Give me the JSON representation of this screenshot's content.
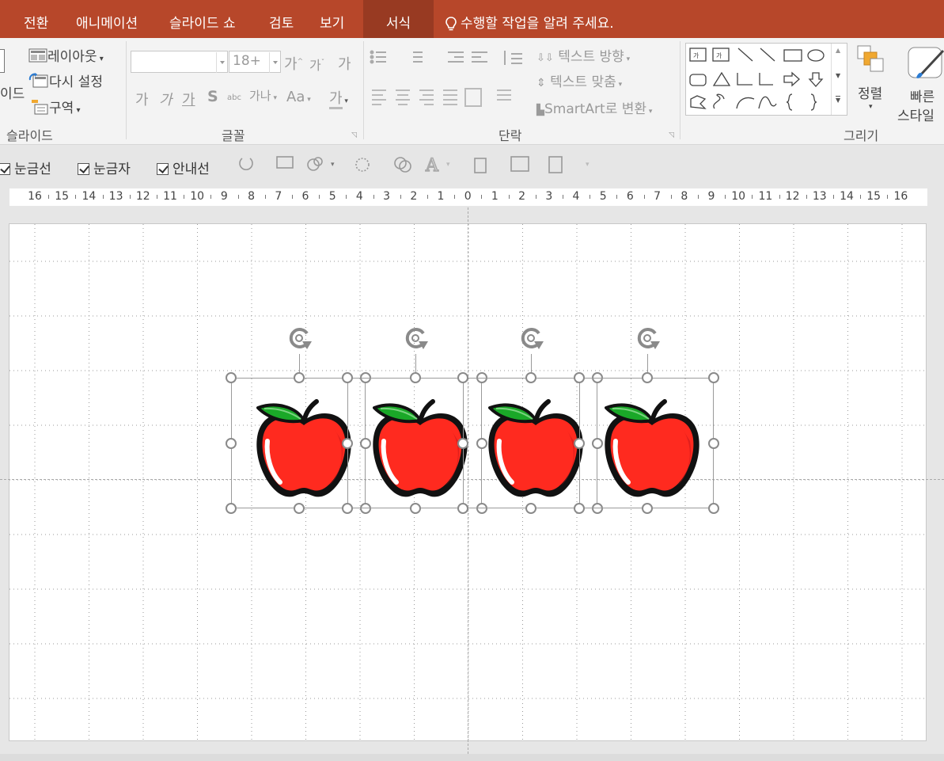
{
  "tabs": [
    {
      "label": "전환",
      "active": false
    },
    {
      "label": "애니메이션",
      "active": false
    },
    {
      "label": "슬라이드 쇼",
      "active": false
    },
    {
      "label": "검토",
      "active": false
    },
    {
      "label": "보기",
      "active": false
    },
    {
      "label": "서식",
      "active": true
    }
  ],
  "tell_me": "수행할 작업을 알려 주세요.",
  "ribbon": {
    "slides": {
      "partial_label": "이드",
      "layout": "레이아웃",
      "reset": "다시 설정",
      "section": "구역",
      "group_label": "슬라이드"
    },
    "font": {
      "font_name": "",
      "font_size": "18+",
      "grow": "가",
      "shrink": "가",
      "clear": "가",
      "bold": "가",
      "italic": "가",
      "underline": "가",
      "shadow": "S",
      "spacing": "가나",
      "change_case": "Aa",
      "font_color": "가",
      "group_label": "글꼴"
    },
    "paragraph": {
      "text_direction": "텍스트 방향",
      "align_text": "텍스트 맞춤",
      "smartart": "SmartArt로 변환",
      "group_label": "단락"
    },
    "drawing": {
      "arrange": "정렬",
      "quick_styles_1": "빠른",
      "quick_styles_2": "스타일",
      "group_label": "그리기"
    }
  },
  "view": {
    "gridlines": "눈금선",
    "ruler": "눈금자",
    "guides": "안내선"
  },
  "ruler_labels": [
    "16",
    "15",
    "14",
    "13",
    "12",
    "11",
    "10",
    "9",
    "8",
    "7",
    "6",
    "5",
    "4",
    "3",
    "2",
    "1",
    "0",
    "1",
    "2",
    "3",
    "4",
    "5",
    "6",
    "7",
    "8",
    "9",
    "10",
    "11",
    "12",
    "13",
    "14",
    "15",
    "16"
  ],
  "colors": {
    "accent": "#b7472a",
    "apple_red": "#ff2a1f",
    "leaf_green": "#1aa828"
  }
}
